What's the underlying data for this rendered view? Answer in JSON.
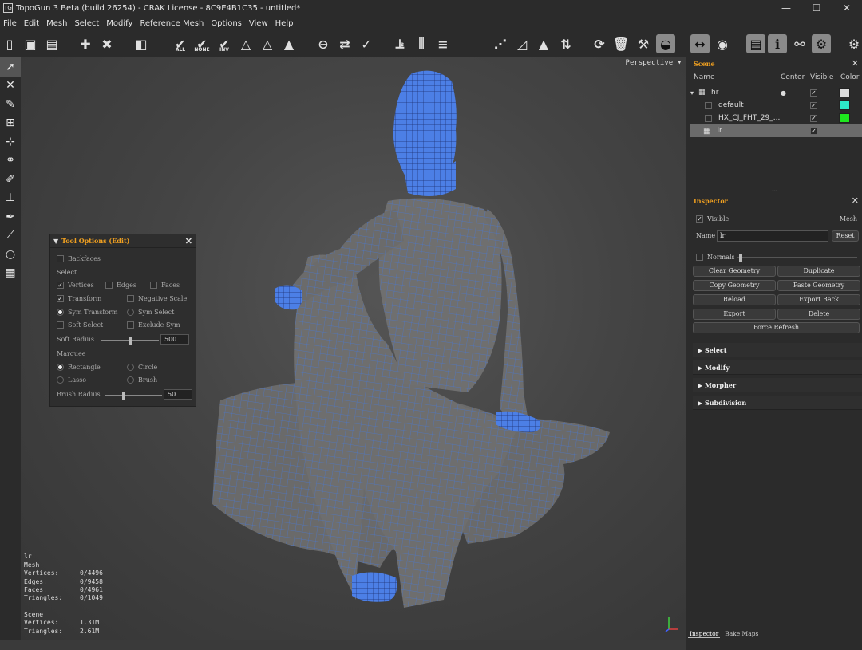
{
  "window": {
    "title": "TopoGun 3 Beta (build 26254) - CRAK License - 8C9E4B1C35 - untitled*",
    "logo": "TG",
    "min": "—",
    "max": "☐",
    "close": "✕"
  },
  "menu": [
    "File",
    "Edit",
    "Mesh",
    "Select",
    "Modify",
    "Reference Mesh",
    "Options",
    "View",
    "Help"
  ],
  "toolbar": {
    "all": "ALL",
    "none": "NONE",
    "inv": "INV"
  },
  "viewport": {
    "mode": "Perspective ▾",
    "stats": {
      "object": "lr",
      "type": "Mesh",
      "rows": [
        {
          "k": "Vertices:",
          "v": "0/4496"
        },
        {
          "k": "Edges:",
          "v": "0/9458"
        },
        {
          "k": "Faces:",
          "v": "0/4961"
        },
        {
          "k": "Triangles:",
          "v": "0/1049"
        }
      ],
      "scene_label": "Scene",
      "scene_rows": [
        {
          "k": "Vertices:",
          "v": "1.31M"
        },
        {
          "k": "Triangles:",
          "v": "2.61M"
        }
      ]
    }
  },
  "tool_options": {
    "title": "Tool Options (Edit)",
    "backfaces": "Backfaces",
    "select_label": "Select",
    "vertices": "Vertices",
    "edges": "Edges",
    "faces": "Faces",
    "transform": "Transform",
    "negative_scale": "Negative Scale",
    "sym_transform": "Sym Transform",
    "sym_select": "Sym Select",
    "soft_select": "Soft Select",
    "exclude_sym": "Exclude Sym",
    "soft_radius": "Soft Radius",
    "soft_radius_value": "500",
    "soft_radius_fraction": 0.47,
    "marquee_label": "Marquee",
    "rectangle": "Rectangle",
    "circle": "Circle",
    "lasso": "Lasso",
    "brush": "Brush",
    "brush_radius": "Brush Radius",
    "brush_radius_value": "50",
    "brush_radius_fraction": 0.3,
    "check": "✓"
  },
  "scene": {
    "title": "Scene",
    "cols": {
      "name": "Name",
      "center": "Center",
      "visible": "Visible",
      "color": "Color"
    },
    "rows": [
      {
        "name": "hr",
        "check": "✓",
        "color": "#dddddd"
      },
      {
        "name": "default",
        "check": "✓",
        "color": "#2de8c8"
      },
      {
        "name": "HX_CJ_FHT_29_...",
        "check": "✓",
        "color": "#1ee81e"
      },
      {
        "name": "lr",
        "check": "✓",
        "color": ""
      }
    ]
  },
  "inspector": {
    "title": "Inspector",
    "visible": "Visible",
    "mesh": "Mesh",
    "name_label": "Name",
    "name_value": "lr",
    "reset": "Reset",
    "normals": "Normals",
    "buttons": [
      "Clear Geometry",
      "Duplicate",
      "Copy Geometry",
      "Paste Geometry",
      "Reload",
      "Export Back",
      "Export",
      "Delete"
    ],
    "force_refresh": "Force Refresh",
    "sections": [
      "Select",
      "Modify",
      "Morpher",
      "Subdivision"
    ]
  },
  "bottom_tabs": [
    "Inspector",
    "Bake Maps"
  ]
}
